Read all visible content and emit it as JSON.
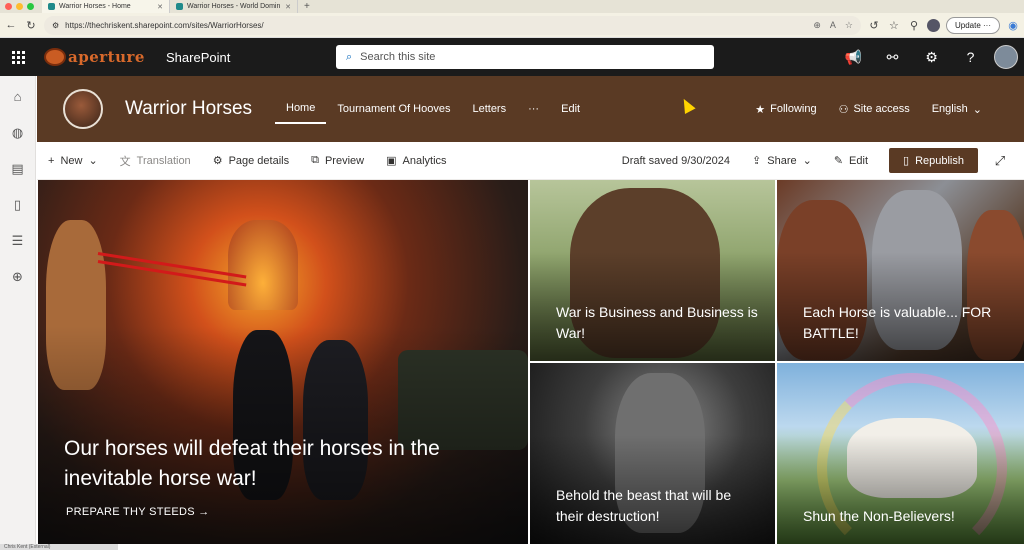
{
  "browser": {
    "tabs": [
      {
        "title": "Warrior Horses - Home",
        "active": true
      },
      {
        "title": "Warrior Horses - World Domin",
        "active": false
      }
    ],
    "url": "https://thechriskent.sharepoint.com/sites/WarriorHorses/",
    "update_label": "Update"
  },
  "suite": {
    "brand": "aperture",
    "app_name": "SharePoint",
    "search_placeholder": "Search this site"
  },
  "site": {
    "title": "Warrior Horses",
    "nav": [
      "Home",
      "Tournament Of Hooves",
      "Letters",
      "···",
      "Edit"
    ],
    "following_label": "Following",
    "access_label": "Site access",
    "language_label": "English"
  },
  "commands": {
    "new_label": "New",
    "translation_label": "Translation",
    "page_details_label": "Page details",
    "preview_label": "Preview",
    "analytics_label": "Analytics",
    "draft_status": "Draft saved 9/30/2024",
    "share_label": "Share",
    "edit_label": "Edit",
    "republish_label": "Republish"
  },
  "hero": {
    "main": {
      "caption": "Our horses will defeat their horses in the inevitable horse war!",
      "cta": "PREPARE THY STEEDS →"
    },
    "tiles": [
      {
        "caption": "War is Business and Business is War!"
      },
      {
        "caption": "Each Horse is valuable... FOR BATTLE!"
      },
      {
        "caption": "Behold the beast that will be their destruction!"
      },
      {
        "caption": "Shun the Non-Believers!"
      }
    ]
  },
  "colors": {
    "theme": "#5a3a24",
    "suitebar": "#1b1b1b",
    "brand_orange": "#d8692b"
  },
  "status_text": "Chris Kent (External)"
}
